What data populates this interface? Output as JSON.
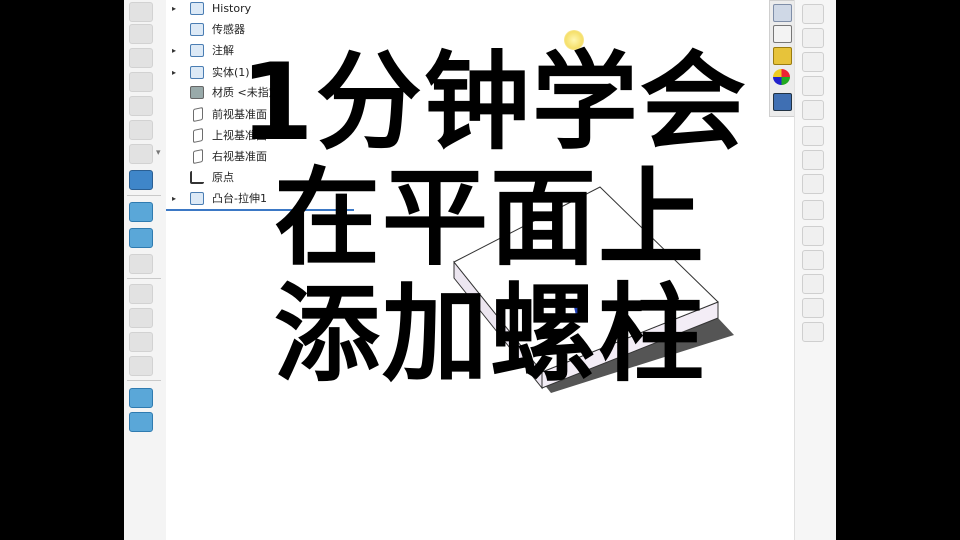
{
  "feature_tree": {
    "items": [
      {
        "label": "History",
        "expandable": true,
        "icon": "history-icon"
      },
      {
        "label": "传感器",
        "expandable": false,
        "icon": "sensor-icon"
      },
      {
        "label": "注解",
        "expandable": true,
        "icon": "annotation-icon"
      },
      {
        "label": "实体(1)",
        "expandable": true,
        "icon": "solid-body-icon"
      },
      {
        "label": "材质 <未指定>",
        "expandable": false,
        "icon": "material-icon"
      },
      {
        "label": "前视基准面",
        "expandable": false,
        "icon": "plane-icon"
      },
      {
        "label": "上视基准面",
        "expandable": false,
        "icon": "plane-icon"
      },
      {
        "label": "右视基准面",
        "expandable": false,
        "icon": "plane-icon"
      },
      {
        "label": "原点",
        "expandable": false,
        "icon": "origin-icon"
      },
      {
        "label": "凸台-拉伸1",
        "expandable": true,
        "icon": "boss-extrude-icon"
      }
    ]
  },
  "headline": {
    "line1": "1分钟学会",
    "line2": "在平面上",
    "line3": "添加螺柱"
  },
  "colors": {
    "accent": "#3b78c5",
    "block_top": "#ffffff",
    "block_side": "#e9e2ee",
    "block_shadow": "#555555"
  }
}
